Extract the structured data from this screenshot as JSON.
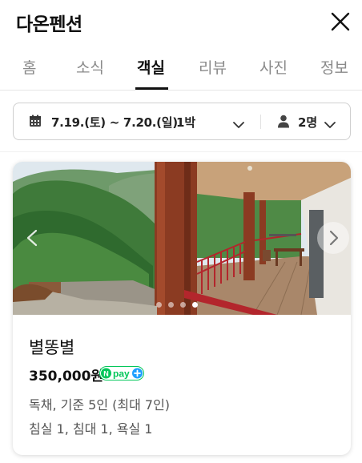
{
  "header": {
    "title": "다온펜션"
  },
  "tabs": [
    {
      "label": "홈"
    },
    {
      "label": "소식"
    },
    {
      "label": "객실"
    },
    {
      "label": "리뷰"
    },
    {
      "label": "사진"
    },
    {
      "label": "정보"
    }
  ],
  "active_tab": "객실",
  "booking": {
    "dates": "7.19.(토) ~ 7.20.(일)",
    "nights": "1박",
    "guests": "2명"
  },
  "room": {
    "name": "별똥별",
    "price": "350,000원",
    "badge": "pay",
    "details": "독채, 기준 5인 (최대 7인)",
    "facilities": "침실 1, 침대 1, 욕실 1",
    "photo_count": 4,
    "active_photo": 4
  },
  "colors": {
    "text": "#111111",
    "muted": "#8a8a8a",
    "npay_green": "#03c75a",
    "npay_blue": "#1ea0ff",
    "railing": "#b3262c"
  },
  "icons": [
    "close-icon",
    "calendar-icon",
    "chevron-down-icon",
    "person-icon",
    "chevron-left-icon",
    "chevron-right-icon"
  ]
}
